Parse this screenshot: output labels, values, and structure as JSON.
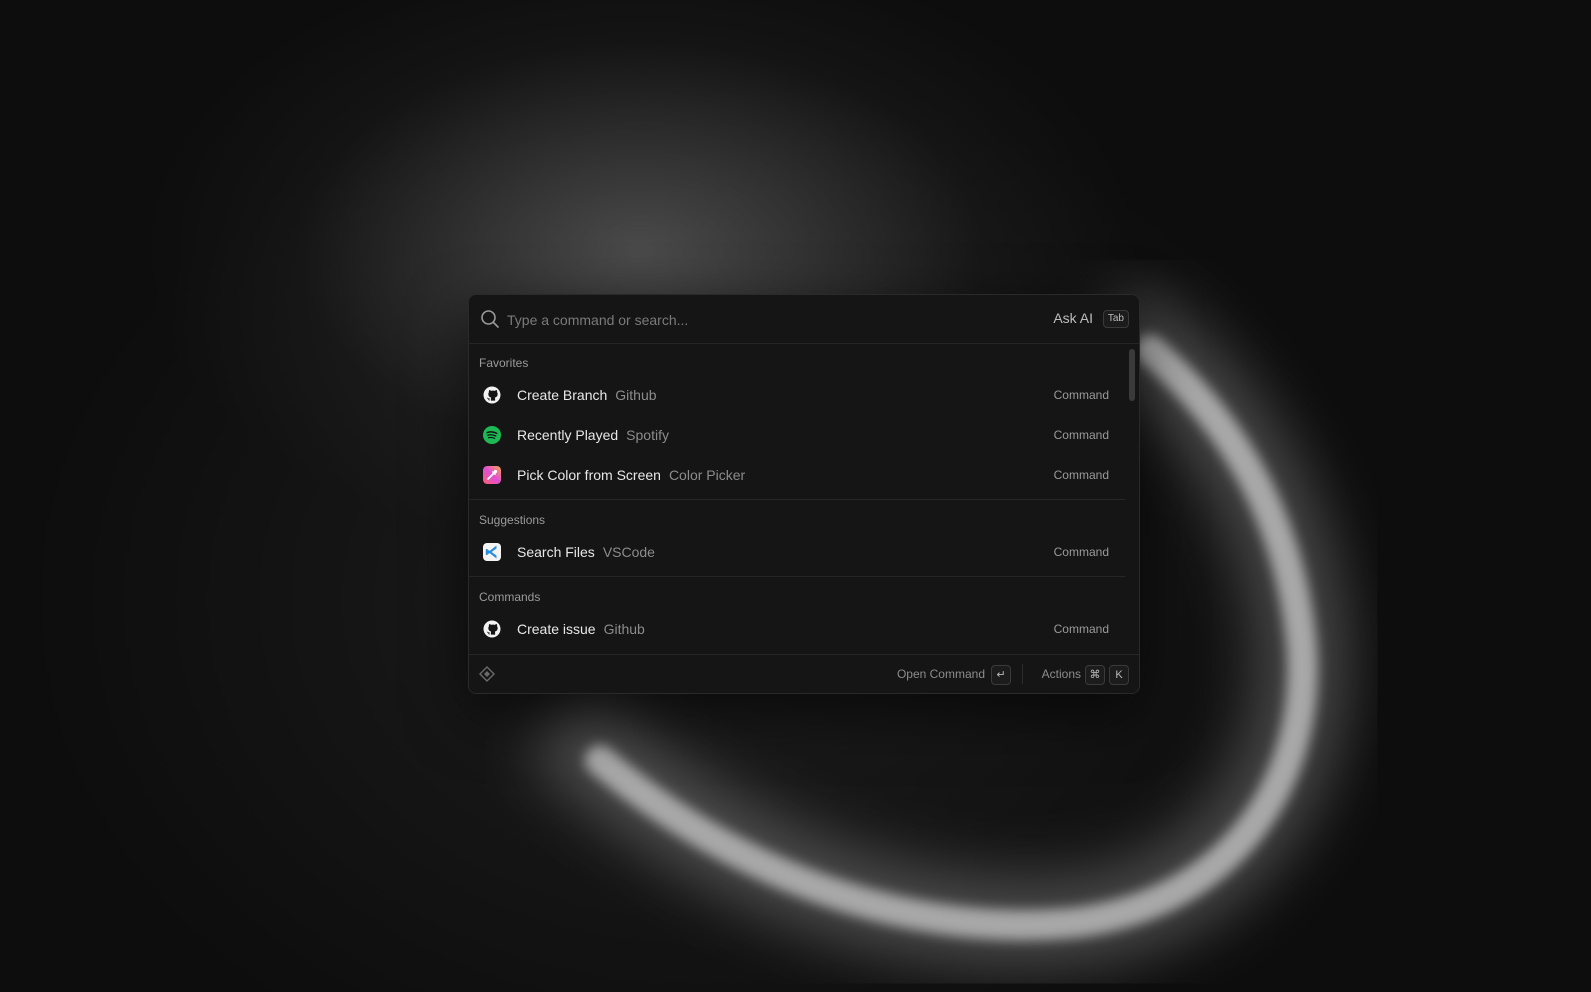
{
  "search": {
    "placeholder": "Type a command or search...",
    "ask_ai_label": "Ask AI",
    "ask_ai_key": "Tab"
  },
  "sections": [
    {
      "label": "Favorites",
      "items": [
        {
          "icon": "github-icon",
          "title": "Create Branch",
          "subtitle": "Github",
          "type": "Command"
        },
        {
          "icon": "spotify-icon",
          "title": "Recently Played",
          "subtitle": "Spotify",
          "type": "Command"
        },
        {
          "icon": "color-picker-icon",
          "title": "Pick Color from Screen",
          "subtitle": "Color Picker",
          "type": "Command"
        }
      ]
    },
    {
      "label": "Suggestions",
      "items": [
        {
          "icon": "vscode-icon",
          "title": "Search Files",
          "subtitle": "VSCode",
          "type": "Command"
        }
      ]
    },
    {
      "label": "Commands",
      "items": [
        {
          "icon": "github-icon",
          "title": "Create issue",
          "subtitle": "Github",
          "type": "Command"
        }
      ]
    }
  ],
  "footer": {
    "open_label": "Open Command",
    "enter_key": "↵",
    "actions_label": "Actions",
    "cmd_key": "⌘",
    "k_key": "K"
  },
  "colors": {
    "background": "#0d0d0d",
    "panel": "#151515",
    "spotify_green": "#1db954",
    "vscode_blue": "#2b8fdc"
  }
}
